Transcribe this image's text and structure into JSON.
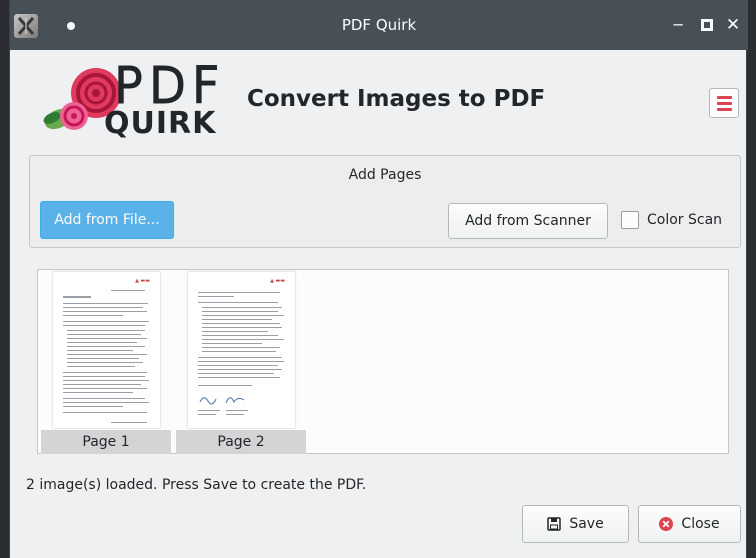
{
  "window": {
    "title": "PDF Quirk"
  },
  "logo": {
    "line1": "PDF",
    "line2": "QUIRK"
  },
  "header": {
    "title": "Convert Images to PDF"
  },
  "add_pages": {
    "title": "Add Pages",
    "add_from_file": "Add from File...",
    "add_from_scanner": "Add from Scanner",
    "color_scan_label": "Color Scan",
    "color_scan_checked": false
  },
  "pages": [
    {
      "label": "Page 1"
    },
    {
      "label": "Page 2"
    }
  ],
  "status": "2 image(s) loaded. Press Save to create the PDF.",
  "footer": {
    "save": "Save",
    "close": "Close"
  },
  "colors": {
    "accent": "#3daee9",
    "primary_button": "#5bb2e8",
    "titlebar": "#475057",
    "close_icon": "#da4453"
  }
}
